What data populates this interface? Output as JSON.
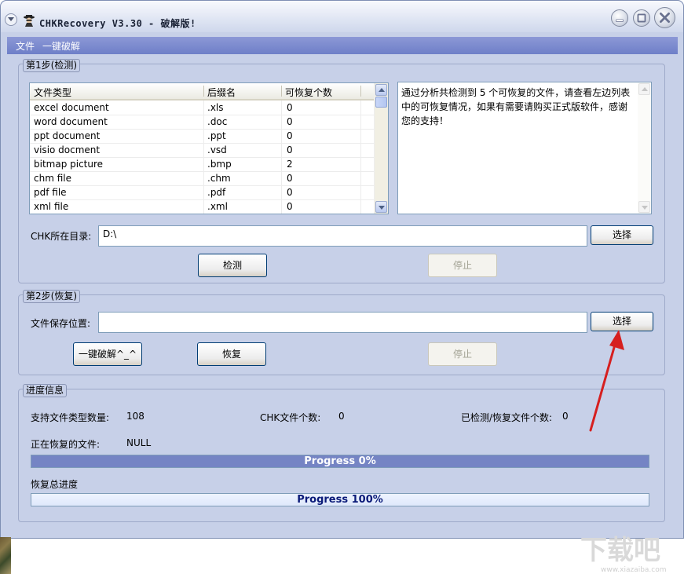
{
  "window": {
    "title": "CHKRecovery V3.30 - 破解版!"
  },
  "menu": {
    "file": "文件",
    "one_click_crack": "一键破解"
  },
  "step1": {
    "group_label": "第1步(检测)",
    "table": {
      "headers": [
        "文件类型",
        "后缀名",
        "可恢复个数"
      ],
      "rows": [
        [
          "excel document",
          ".xls",
          "0"
        ],
        [
          "word document",
          ".doc",
          "0"
        ],
        [
          "ppt document",
          ".ppt",
          "0"
        ],
        [
          "visio docment",
          ".vsd",
          "0"
        ],
        [
          "bitmap picture",
          ".bmp",
          "2"
        ],
        [
          "chm file",
          ".chm",
          "0"
        ],
        [
          "pdf file",
          ".pdf",
          "0"
        ],
        [
          "xml file",
          ".xml",
          "0"
        ]
      ]
    },
    "info_text": "通过分析共检测到 5 个可恢复的文件，请查看左边列表中的可恢复情况，如果有需要请购买正式版软件，感谢您的支持！",
    "chk_dir_label": "CHK所在目录:",
    "chk_dir_value": "D:\\",
    "select_button": "选择",
    "detect_button": "检测",
    "stop_button": "停止"
  },
  "step2": {
    "group_label": "第2步(恢复)",
    "save_location_label": "文件保存位置:",
    "save_location_value": "",
    "select_button": "选择",
    "one_click_button": "一键破解^_^",
    "recover_button": "恢复",
    "stop_button": "停止"
  },
  "progress": {
    "group_label": "进度信息",
    "supported_types_label": "支持文件类型数量:",
    "supported_types_value": "108",
    "chk_count_label": "CHK文件个数:",
    "chk_count_value": "0",
    "detected_label": "已检测/恢复文件个数:",
    "detected_value": "0",
    "current_file_label": "正在恢复的文件:",
    "current_file_value": "NULL",
    "file_progress_text": "Progress 0%",
    "file_progress_percent": 0,
    "total_label": "恢复总进度",
    "total_progress_text": "Progress 100%",
    "total_progress_percent": 100
  },
  "watermark": {
    "text": "下载吧",
    "url": "www.xiazaiba.com"
  },
  "icons": {
    "system_menu": "chevron-down-icon",
    "app": "spy-icon",
    "minimize": "minimize-icon",
    "maximize": "maximize-icon",
    "close": "close-icon",
    "annotation": "red-arrow-icon"
  },
  "colors": {
    "window_bg": "#c7d0e8",
    "menubar": "#7b89cc",
    "annotation_arrow": "#d61f1f",
    "progress_text": "#0a1a78"
  }
}
